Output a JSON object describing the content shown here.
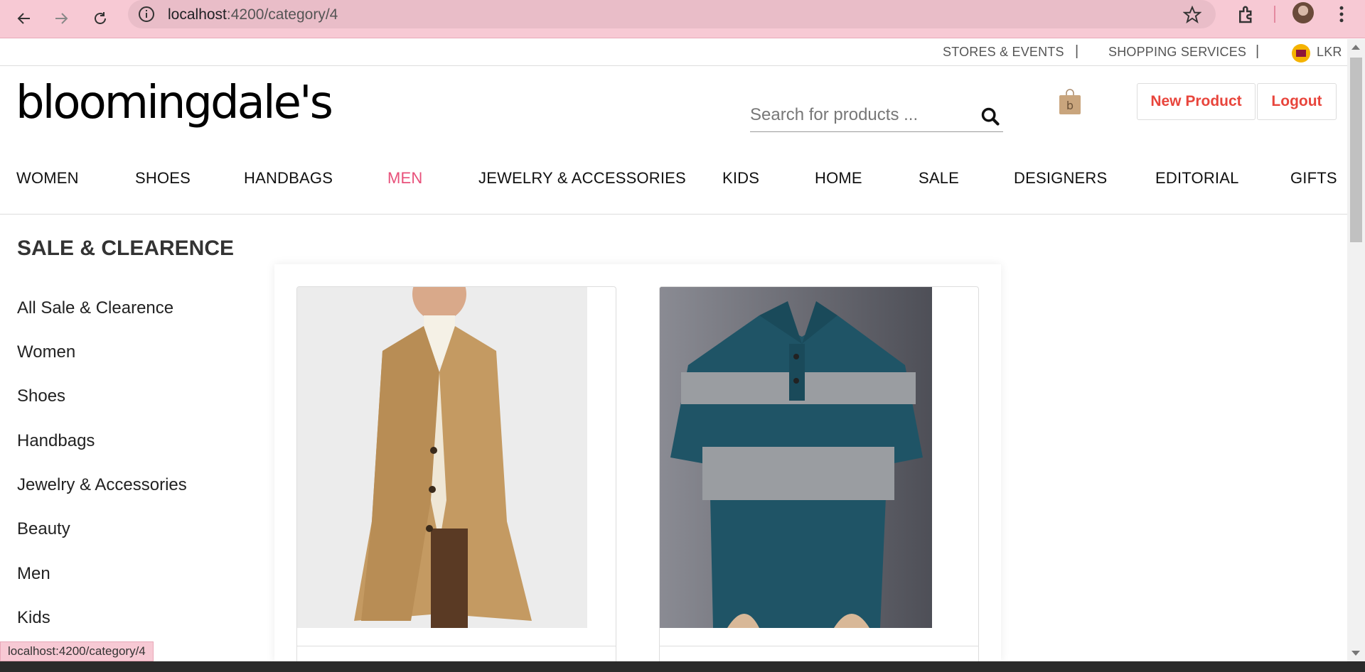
{
  "browser": {
    "url_host": "localhost",
    "url_path": ":4200/category/4"
  },
  "utility": {
    "stores_events": "STORES & EVENTS",
    "sep": "|",
    "shopping_services": "SHOPPING SERVICES",
    "currency": "LKR"
  },
  "header": {
    "logo": "bloomingdale's",
    "search_placeholder": "Search for products ...",
    "new_product": "New Product",
    "logout": "Logout"
  },
  "nav": {
    "items": [
      "WOMEN",
      "SHOES",
      "HANDBAGS",
      "MEN",
      "JEWELRY & ACCESSORIES",
      "KIDS",
      "HOME",
      "SALE",
      "DESIGNERS",
      "EDITORIAL",
      "GIFTS"
    ],
    "active": "MEN"
  },
  "sidebar": {
    "title": "SALE & CLEARENCE",
    "items": [
      "All Sale & Clearence",
      "Women",
      "Shoes",
      "Handbags",
      "Jewelry & Accessories",
      "Beauty",
      "Men",
      "Kids"
    ]
  },
  "status_bar": "localhost:4200/category/4",
  "colors": {
    "chrome_bg": "#f7c9d4",
    "accent_red": "#e8453c",
    "nav_active": "#e8507a"
  }
}
